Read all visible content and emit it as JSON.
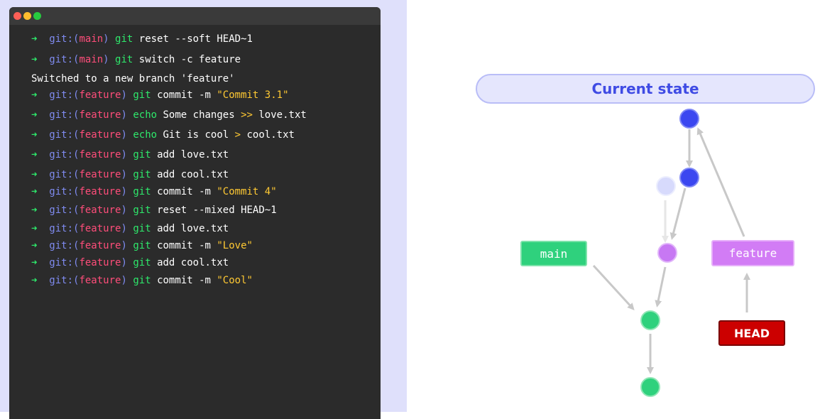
{
  "terminal": {
    "window_buttons": [
      "close",
      "minimize",
      "maximize"
    ],
    "lines": [
      {
        "arrow": "➜",
        "prompt": "git:(",
        "branch": "main",
        "close": ")",
        "cmd": "git",
        "rest": " reset --soft HEAD~1",
        "str": "",
        "op": "",
        "tail": ""
      },
      {
        "arrow": "➜",
        "prompt": "git:(",
        "branch": "main",
        "close": ")",
        "cmd": "git",
        "rest": " switch -c feature",
        "str": "",
        "op": "",
        "tail": ""
      },
      {
        "plain": "Switched to a new branch 'feature'"
      },
      {
        "arrow": "➜",
        "prompt": "git:(",
        "branch": "feature",
        "close": ")",
        "cmd": "git",
        "rest": " commit -m ",
        "str": "\"Commit 3.1\"",
        "op": "",
        "tail": ""
      },
      {
        "arrow": "➜",
        "prompt": "git:(",
        "branch": "feature",
        "close": ")",
        "cmd": "echo",
        "rest": " Some changes ",
        "str": "",
        "op": ">>",
        "tail": " love.txt"
      },
      {
        "arrow": "➜",
        "prompt": "git:(",
        "branch": "feature",
        "close": ")",
        "cmd": "echo",
        "rest": " Git is cool ",
        "str": "",
        "op": ">",
        "tail": " cool.txt"
      },
      {
        "arrow": "➜",
        "prompt": "git:(",
        "branch": "feature",
        "close": ")",
        "cmd": "git",
        "rest": " add love.txt",
        "str": "",
        "op": "",
        "tail": ""
      },
      {
        "arrow": "➜",
        "prompt": "git:(",
        "branch": "feature",
        "close": ")",
        "cmd": "git",
        "rest": " add cool.txt",
        "str": "",
        "op": "",
        "tail": ""
      },
      {
        "arrow": "➜",
        "prompt": "git:(",
        "branch": "feature",
        "close": ")",
        "cmd": "git",
        "rest": " commit -m ",
        "str": "\"Commit 4\"",
        "op": "",
        "tail": ""
      },
      {
        "arrow": "➜",
        "prompt": "git:(",
        "branch": "feature",
        "close": ")",
        "cmd": "git",
        "rest": " reset --mixed HEAD~1",
        "str": "",
        "op": "",
        "tail": ""
      },
      {
        "arrow": "➜",
        "prompt": "git:(",
        "branch": "feature",
        "close": ")",
        "cmd": "git",
        "rest": " add love.txt",
        "str": "",
        "op": "",
        "tail": ""
      },
      {
        "arrow": "➜",
        "prompt": "git:(",
        "branch": "feature",
        "close": ")",
        "cmd": "git",
        "rest": " commit -m ",
        "str": "\"Love\"",
        "op": "",
        "tail": ""
      },
      {
        "arrow": "➜",
        "prompt": "git:(",
        "branch": "feature",
        "close": ")",
        "cmd": "git",
        "rest": " add cool.txt",
        "str": "",
        "op": "",
        "tail": ""
      },
      {
        "arrow": "➜",
        "prompt": "git:(",
        "branch": "feature",
        "close": ")",
        "cmd": "git",
        "rest": " commit -m ",
        "str": "\"Cool\"",
        "op": "",
        "tail": ""
      }
    ]
  },
  "diagram": {
    "title": "Current state",
    "labels": {
      "main": "main",
      "feature": "feature",
      "head": "HEAD"
    },
    "colors": {
      "blue_commit": "#3b47f0",
      "faded_commit": "#d7dafc",
      "purple_commit": "#c778f3",
      "green_commit": "#2fd17d",
      "arrow": "#c8c8c8",
      "head": "#cc0000"
    }
  }
}
